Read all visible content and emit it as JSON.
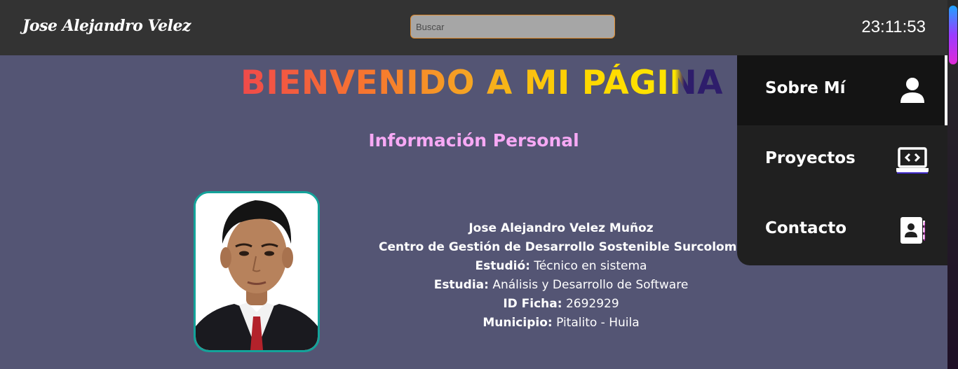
{
  "header": {
    "brand": "Jose Alejandro Velez",
    "search_placeholder": "Buscar",
    "clock": "23:11:53"
  },
  "main": {
    "welcome": "BIENVENIDO A MI PÁGINA",
    "subtitle": "Información Personal",
    "profile": {
      "name": "Jose Alejandro Velez Muñoz",
      "center": "Centro de Gestión de Desarrollo Sostenible Surcolombia",
      "studied_label": "Estudió:",
      "studied_value": "Técnico en sistema",
      "studies_label": "Estudia:",
      "studies_value": "Análisis y Desarrollo de Software",
      "ficha_label": "ID Ficha:",
      "ficha_value": "2692929",
      "municipio_label": "Municipio:",
      "municipio_value": "Pitalito - Huila"
    }
  },
  "menu": {
    "items": [
      {
        "label": "Sobre Mí",
        "icon": "user-icon",
        "active": true
      },
      {
        "label": "Proyectos",
        "icon": "laptop-code-icon",
        "active": false
      },
      {
        "label": "Contacto",
        "icon": "address-book-icon",
        "active": false
      }
    ]
  },
  "colors": {
    "header_bg": "#333333",
    "page_bg": "#545574",
    "menu_bg": "#202020",
    "subtitle": "#f7a9f5",
    "photo_border": "#13a39a",
    "search_border": "#e08a2c"
  }
}
